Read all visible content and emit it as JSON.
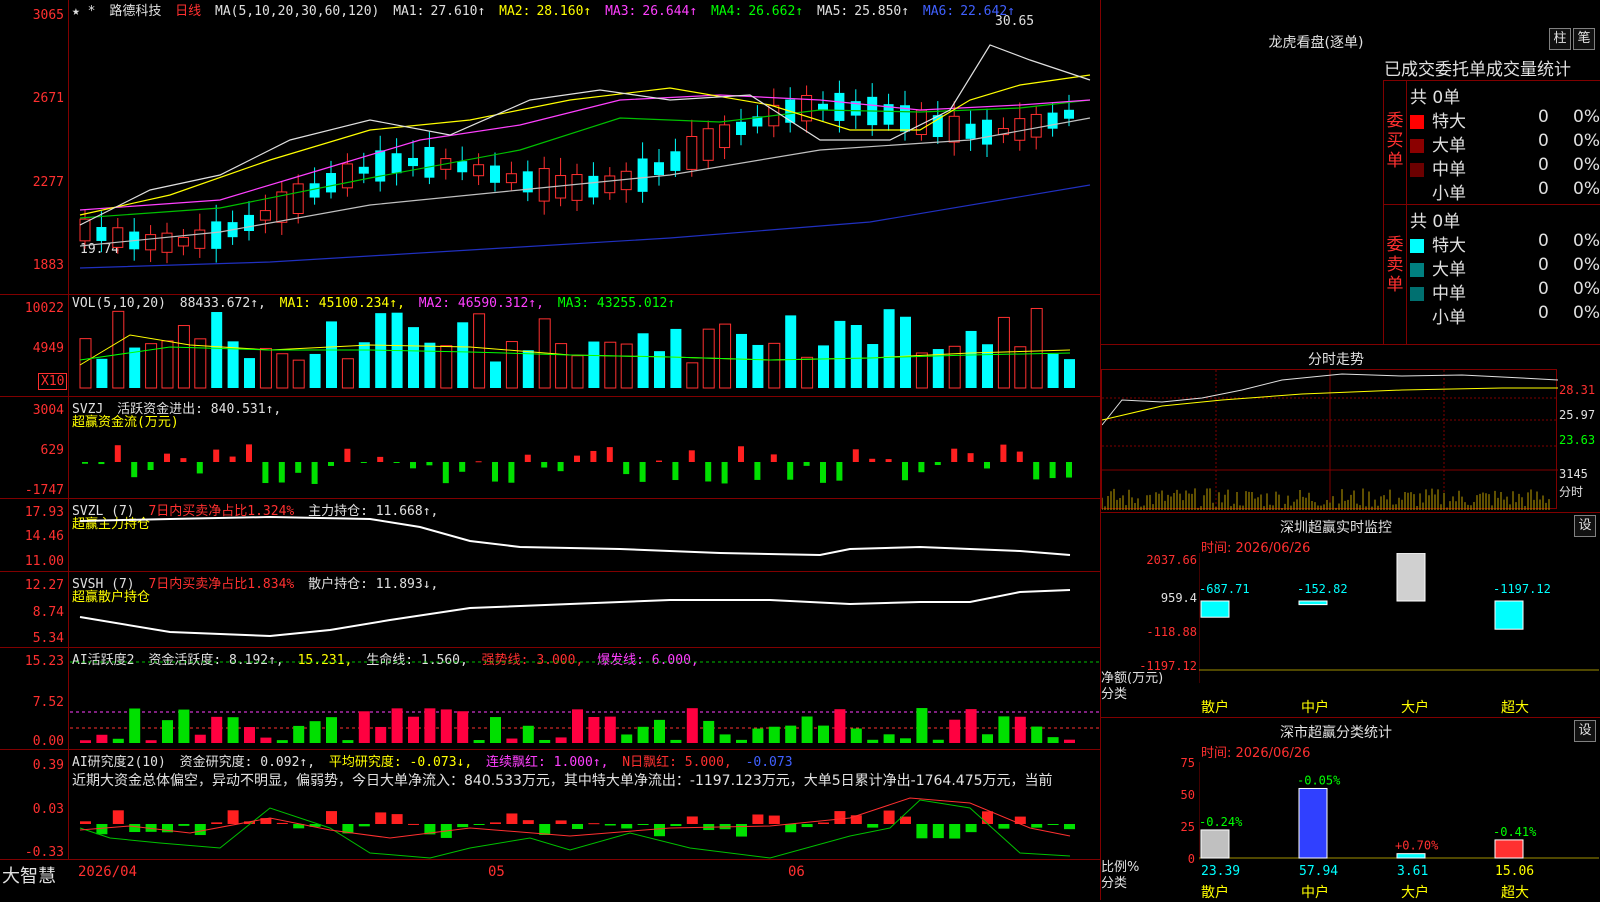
{
  "app": {
    "brand": "大智慧"
  },
  "header": {
    "stock_name": "路德科技",
    "period": "日线",
    "ma_label": "MA(5,10,20,30,60,120)",
    "ma": [
      {
        "name": "MA1:",
        "value": "27.610↑",
        "color": "#e0e0e0"
      },
      {
        "name": "MA2:",
        "value": "28.160↑",
        "color": "#ffff00"
      },
      {
        "name": "MA3:",
        "value": "26.644↑",
        "color": "#ff40ff"
      },
      {
        "name": "MA4:",
        "value": "26.662↑",
        "color": "#00ff00"
      },
      {
        "name": "MA5:",
        "value": "25.850↑",
        "color": "#c0c0c0"
      },
      {
        "name": "MA6:",
        "value": "22.642↑",
        "color": "#4060ff"
      }
    ]
  },
  "price_panel": {
    "y_labels": [
      "3065",
      "2671",
      "2277",
      "1883"
    ],
    "high_label": "30.65",
    "low_label": "19.74"
  },
  "vol_panel": {
    "title": "VOL(5,10,20)",
    "value": "88433.672↑,",
    "ma1": "MA1: 45100.234↑,",
    "ma2": "MA2: 46590.312↑,",
    "ma3": "MA3: 43255.012↑",
    "y_labels": [
      "10022",
      "4949"
    ],
    "unit": "X10"
  },
  "svzj_panel": {
    "title": "SVZJ",
    "text1": "活跃资金进出: 840.531↑,",
    "text2": "超赢资金流(万元)",
    "y_labels": [
      "3004",
      "629",
      "-1747"
    ]
  },
  "svzl_panel": {
    "title": "SVZL (7)",
    "text1": "7日内买卖净占比1.324%",
    "text2": "主力持仓: 11.668↑,",
    "text3": "超赢主力持仓",
    "y_labels": [
      "17.93",
      "14.46",
      "11.00"
    ]
  },
  "svsh_panel": {
    "title": "SVSH (7)",
    "text1": "7日内买卖净占比1.834%",
    "text2": "散户持仓: 11.893↓,",
    "text3": "超赢散户持仓",
    "y_labels": [
      "12.27",
      "8.74",
      "5.34"
    ]
  },
  "ai_active_panel": {
    "title": "AI活跃度2",
    "text1": "资金活跃度: 8.192↑,",
    "text2": "15.231,",
    "text3": "生命线: 1.560,",
    "text4": "强势线: 3.000,",
    "text5": "爆发线: 6.000,",
    "y_labels": [
      "15.23",
      "7.52",
      "0.00"
    ]
  },
  "ai_research_panel": {
    "title": "AI研究度2(10)",
    "text1": "资金研究度: 0.092↑,",
    "text2": "平均研究度: -0.073↓,",
    "text3": "连续飘红: 1.000↑,",
    "text4": "N日飘红: 5.000,",
    "text5": "-0.073",
    "commentary": "近期大资金总体偏空，异动不明显，偏弱势，今日大单净流入：840.533万元，其中特大单净流出：-1197.123万元，大单5日累计净出-1764.475万元，当前",
    "y_labels": [
      "0.39",
      "0.03",
      "-0.33"
    ]
  },
  "x_axis": {
    "labels": [
      "2026/04",
      "05",
      "06"
    ]
  },
  "dragon_tiger": {
    "title": "龙虎看盘(逐单)",
    "btn1": "柱",
    "btn2": "笔",
    "header": "已成交委托单成交量统计",
    "buy_label": "委买单",
    "sell_label": "委卖单",
    "buy_total": "共 0单",
    "sell_total": "共 0单",
    "buy_rows": [
      {
        "name": "特大",
        "count": "0",
        "pct": "0%",
        "color": "#ff0000"
      },
      {
        "name": "大单",
        "count": "0",
        "pct": "0%",
        "color": "#8b0000"
      },
      {
        "name": "中单",
        "count": "0",
        "pct": "0%",
        "color": "#6b0000"
      },
      {
        "name": "小单",
        "count": "0",
        "pct": "0%",
        "color": ""
      }
    ],
    "sell_rows": [
      {
        "name": "特大",
        "count": "0",
        "pct": "0%",
        "color": "#00ffff"
      },
      {
        "name": "大单",
        "count": "0",
        "pct": "0%",
        "color": "#008080"
      },
      {
        "name": "中单",
        "count": "0",
        "pct": "0%",
        "color": "#007070"
      },
      {
        "name": "小单",
        "count": "0",
        "pct": "0%",
        "color": ""
      }
    ]
  },
  "intraday": {
    "title": "分时走势",
    "y_labels": [
      "28.31",
      "25.97",
      "23.63",
      "3145",
      "分时"
    ]
  },
  "sz_monitor": {
    "title": "深圳超赢实时监控",
    "btn": "设",
    "time": "时间: 2026/06/26",
    "y_labels": [
      "2037.66",
      "959.4",
      "-118.88",
      "-1197.12"
    ],
    "bar_values": [
      "-687.71",
      "-152.82",
      "2037.66",
      "-1197.12"
    ],
    "axis_label1": "净额(万元)",
    "axis_label2": "分类",
    "categories": [
      "散户",
      "中户",
      "大户",
      "超大"
    ]
  },
  "sz_category": {
    "title": "深市超赢分类统计",
    "btn": "设",
    "time": "时间: 2026/06/26",
    "y_labels": [
      "75",
      "50",
      "25",
      "0"
    ],
    "changes": [
      "-0.24%",
      "-0.05%",
      "+0.70%",
      "-0.41%"
    ],
    "values": [
      "23.39",
      "57.94",
      "3.61",
      "15.06"
    ],
    "axis_label1": "比例%",
    "axis_label2": "分类",
    "categories": [
      "散户",
      "中户",
      "大户",
      "超大"
    ]
  }
}
